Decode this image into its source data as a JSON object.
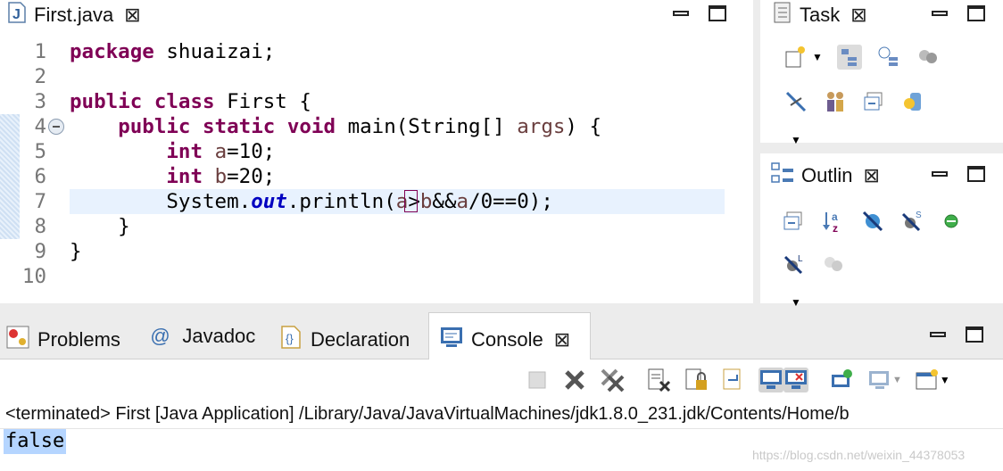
{
  "editor": {
    "tab_title": "First.java",
    "lines": [
      {
        "num": "1",
        "tokens": [
          {
            "t": "package",
            "c": "kw"
          },
          {
            "t": " shuaizai;",
            "c": ""
          }
        ]
      },
      {
        "num": "2",
        "tokens": []
      },
      {
        "num": "3",
        "tokens": [
          {
            "t": "public",
            "c": "kw"
          },
          {
            "t": " ",
            "c": ""
          },
          {
            "t": "class",
            "c": "kw"
          },
          {
            "t": " First {",
            "c": ""
          }
        ]
      },
      {
        "num": "4",
        "tokens": [
          {
            "t": "    ",
            "c": ""
          },
          {
            "t": "public",
            "c": "kw"
          },
          {
            "t": " ",
            "c": ""
          },
          {
            "t": "static",
            "c": "kw"
          },
          {
            "t": " ",
            "c": ""
          },
          {
            "t": "void",
            "c": "kw"
          },
          {
            "t": " main(String[] ",
            "c": ""
          },
          {
            "t": "args",
            "c": "var"
          },
          {
            "t": ") {",
            "c": ""
          }
        ]
      },
      {
        "num": "5",
        "tokens": [
          {
            "t": "        ",
            "c": ""
          },
          {
            "t": "int",
            "c": "kw"
          },
          {
            "t": " ",
            "c": ""
          },
          {
            "t": "a",
            "c": "var"
          },
          {
            "t": "=10;",
            "c": ""
          }
        ]
      },
      {
        "num": "6",
        "tokens": [
          {
            "t": "        ",
            "c": ""
          },
          {
            "t": "int",
            "c": "kw"
          },
          {
            "t": " ",
            "c": ""
          },
          {
            "t": "b",
            "c": "var"
          },
          {
            "t": "=20;",
            "c": ""
          }
        ]
      },
      {
        "num": "7",
        "tokens": [
          {
            "t": "        System.",
            "c": ""
          },
          {
            "t": "out",
            "c": "fld"
          },
          {
            "t": ".println(",
            "c": ""
          },
          {
            "t": "a",
            "c": "var"
          },
          {
            "t": ">",
            "c": ""
          },
          {
            "t": "b",
            "c": "var"
          },
          {
            "t": "&&",
            "c": ""
          },
          {
            "t": "a",
            "c": "var"
          },
          {
            "t": "/0==0);",
            "c": ""
          }
        ]
      },
      {
        "num": "8",
        "tokens": [
          {
            "t": "    }",
            "c": ""
          }
        ]
      },
      {
        "num": "9",
        "tokens": [
          {
            "t": "}",
            "c": ""
          }
        ]
      },
      {
        "num": "10",
        "tokens": []
      }
    ]
  },
  "task_view": {
    "tab_title": "Task"
  },
  "outline_view": {
    "tab_title": "Outlin"
  },
  "bottom_tabs": {
    "problems": "Problems",
    "javadoc": "Javadoc",
    "javadoc_icon": "@",
    "declaration": "Declaration",
    "console": "Console"
  },
  "console": {
    "status": "<terminated> First [Java Application] /Library/Java/JavaVirtualMachines/jdk1.8.0_231.jdk/Contents/Home/b",
    "output": "false",
    "watermark": "https://blog.csdn.net/weixin_44378053"
  },
  "colors": {
    "keyword": "#7f0055",
    "variable": "#6a3e3e",
    "field": "#0000c0",
    "current_line": "#e8f2fe",
    "selection": "#b5d5ff"
  }
}
